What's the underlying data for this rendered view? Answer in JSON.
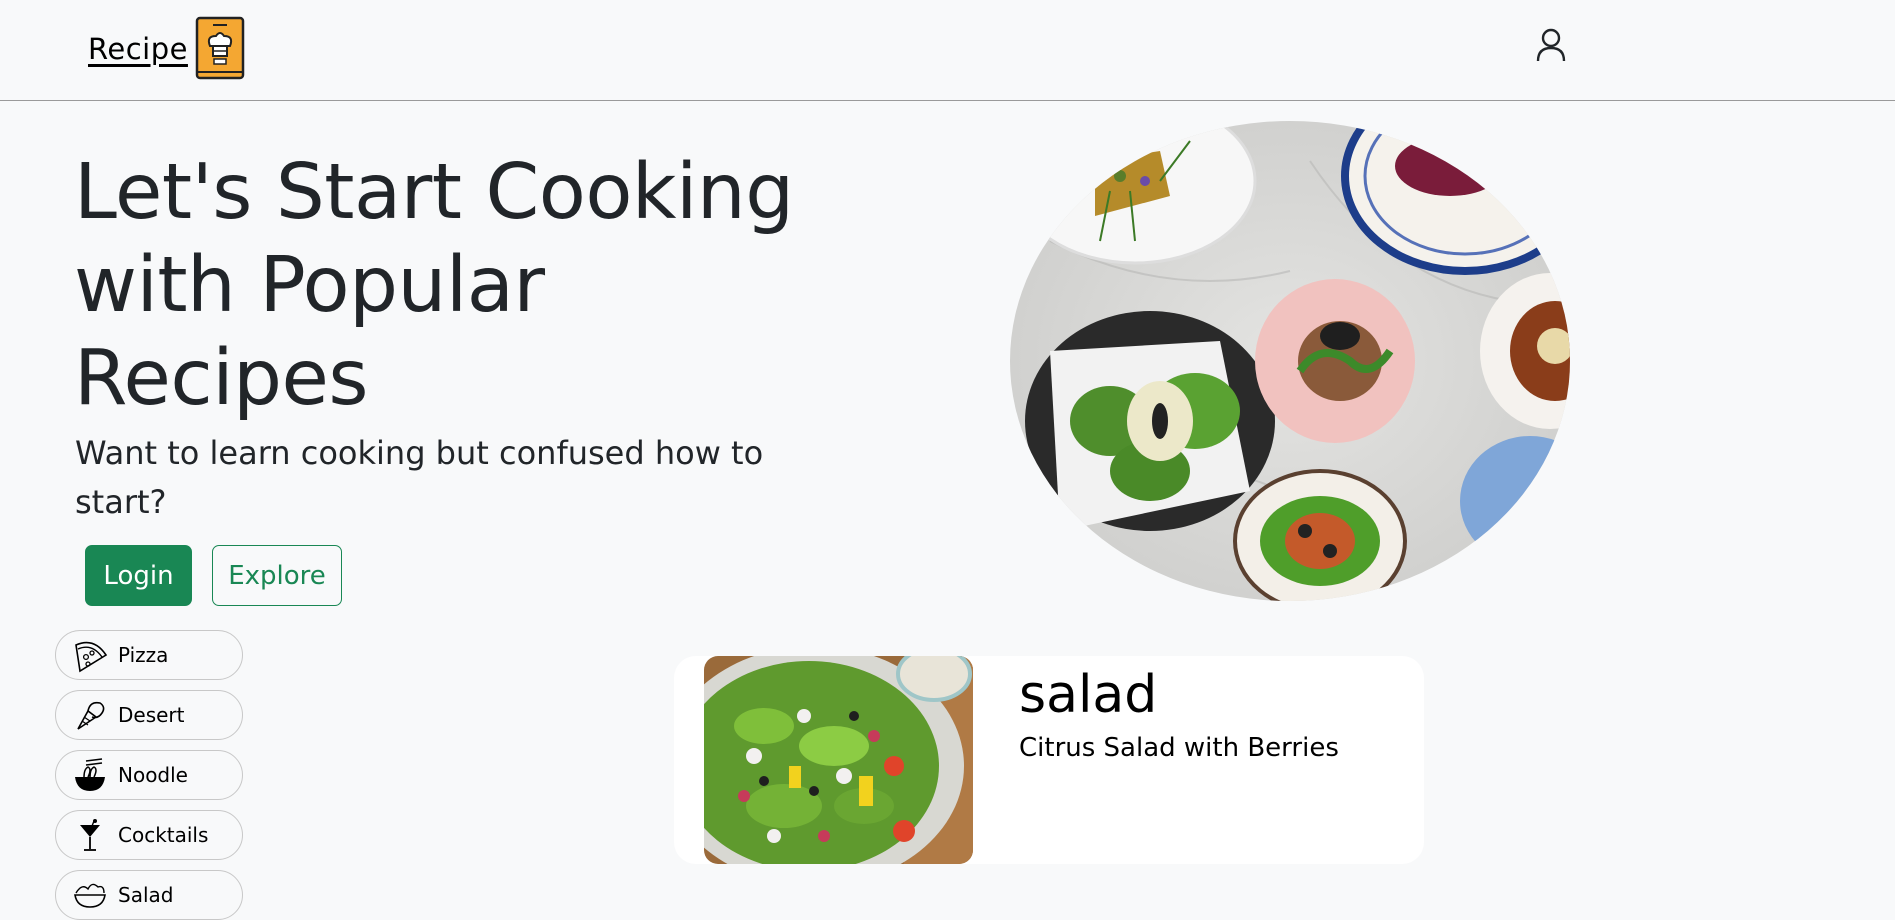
{
  "navbar": {
    "logo_text": "Recipe",
    "logo_icon": "chef-book-icon",
    "user_icon": "user-icon"
  },
  "hero": {
    "title": "Let's Start Cooking with Popular Recipes",
    "subtitle": "Want to learn cooking but confused how to start?",
    "login_label": "Login",
    "explore_label": "Explore",
    "image": "plated-dishes-photo"
  },
  "categories": [
    {
      "label": "Pizza",
      "icon": "pizza-icon"
    },
    {
      "label": "Desert",
      "icon": "ice-cream-icon"
    },
    {
      "label": "Noodle",
      "icon": "noodle-bowl-icon"
    },
    {
      "label": "Cocktails",
      "icon": "cocktail-icon"
    },
    {
      "label": "Salad",
      "icon": "salad-icon"
    }
  ],
  "card": {
    "title": "salad",
    "description": "Citrus Salad with Berries",
    "image": "salad-photo"
  },
  "colors": {
    "accent": "#198754",
    "background": "#f8f9fa",
    "logo_book": "#f4a732"
  }
}
